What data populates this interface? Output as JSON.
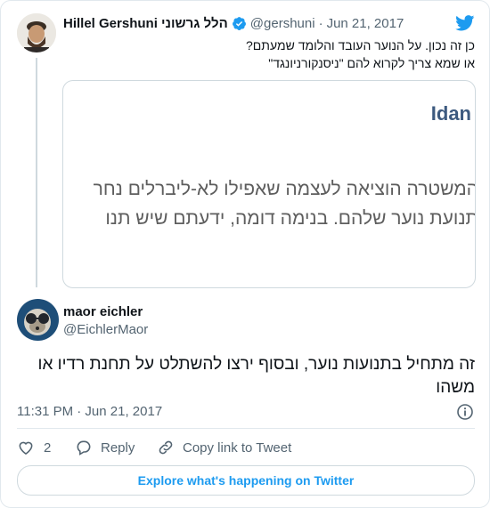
{
  "parent_tweet": {
    "display_name": "Hillel Gershuni הלל גרשוני",
    "handle": "@gershuni",
    "separator": "·",
    "date": "Jun 21, 2017",
    "line1": "כן זה נכון. על הנוער העובד והלומד שמעתם?",
    "line2": "או שמא צריך לקרוא להם \"ניסנקורניונגד\"",
    "image": {
      "header": "Idan",
      "line1": "המשטרה הוציאה לעצמה שאפילו לא-ליברלים נחר",
      "line2": "תנועת נוער שלהם. בנימה דומה, ידעתם שיש תנו"
    }
  },
  "main_tweet": {
    "display_name": "maor eichler",
    "handle": "@EichlerMaor",
    "text": "זה מתחיל בתנועות נוער, ובסוף ירצו להשתלט על תחנת רדיו או משהו",
    "timestamp": "11:31 PM · Jun 21, 2017"
  },
  "actions": {
    "like_count": "2",
    "reply_label": "Reply",
    "copy_label": "Copy link to Tweet"
  },
  "explore_label": "Explore what's happening on Twitter",
  "colors": {
    "twitter_blue": "#1d9bf0",
    "verified_blue": "#1d9bf0",
    "text_primary": "#0f1419",
    "text_muted": "#536471",
    "border": "#cfd9de"
  },
  "icons": [
    "twitter-bird-icon",
    "verified-badge-icon",
    "info-icon",
    "heart-icon",
    "reply-icon",
    "link-icon"
  ]
}
